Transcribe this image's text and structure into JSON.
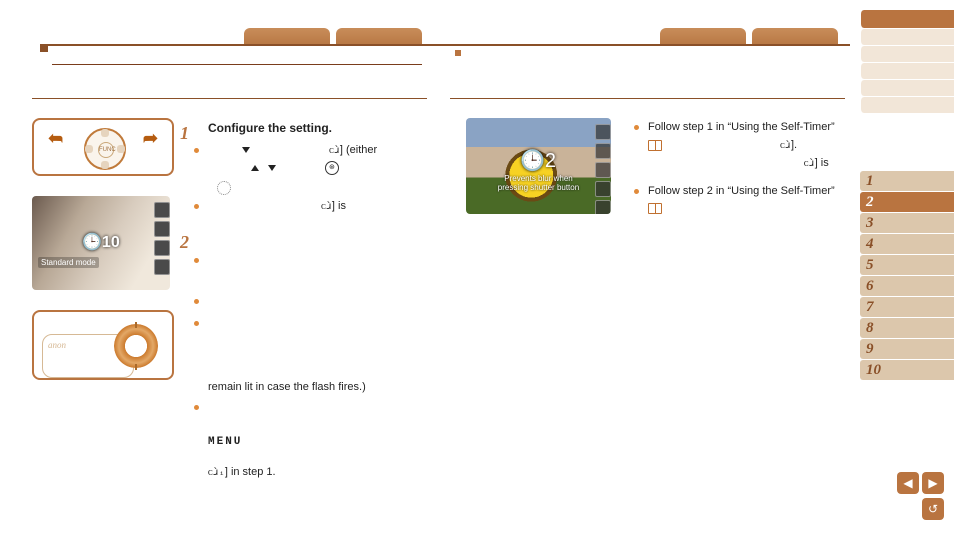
{
  "header": {
    "left_title": "",
    "tabs": [
      "",
      "",
      "",
      ""
    ]
  },
  "sidebar": {
    "top_blocks": 5,
    "chapters": [
      {
        "num": "1",
        "active": false
      },
      {
        "num": "2",
        "active": true
      },
      {
        "num": "3",
        "active": false
      },
      {
        "num": "4",
        "active": false
      },
      {
        "num": "5",
        "active": false
      },
      {
        "num": "6",
        "active": false
      },
      {
        "num": "7",
        "active": false
      },
      {
        "num": "8",
        "active": false
      },
      {
        "num": "9",
        "active": false
      },
      {
        "num": "10",
        "active": false
      }
    ]
  },
  "left_diagrams": {
    "dial_center": "FUNC",
    "photo1_caption": "Standard mode",
    "photo1_timer": "10",
    "camera_brand": "anon"
  },
  "steps": {
    "s1_num": "1",
    "s1_title": "Configure the setting.",
    "s1_b1_tail": "] (either",
    "s1_b3_tail": "] is",
    "s2_num": "2",
    "s2_lamp": "remain lit in case the flash fires.)",
    "menu_label": "MENU",
    "s2_tailnote": "] in step 1."
  },
  "right_photo": {
    "overlay_line1": "Prevents blur when",
    "overlay_line2": "pressing shutter button",
    "badge": "2"
  },
  "right_col": {
    "b1_text": "Follow step 1 in “Using the Self-Timer”",
    "b1_tail1": "].",
    "b1_tail2": "] is",
    "b2_text": "Follow step 2 in “Using the Self-Timer”"
  },
  "nav": {
    "prev": "◀",
    "next": "▶",
    "back": "↺"
  }
}
